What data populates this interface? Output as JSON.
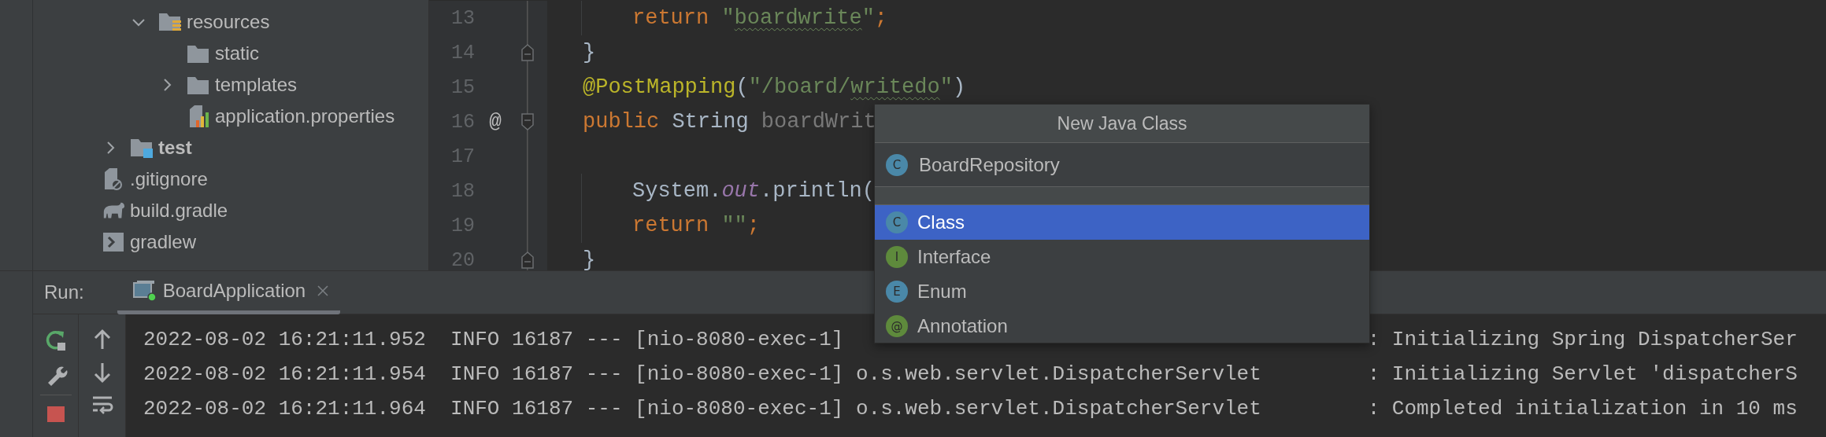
{
  "project_tree": {
    "items": [
      {
        "children": [
          {
            "children": [
              {
                "kind": "resources-folder",
                "label": "resources",
                "expanded": true,
                "children": [
                  {
                    "kind": "folder",
                    "label": "static"
                  },
                  {
                    "kind": "folder",
                    "label": "templates",
                    "expanded": false
                  },
                  {
                    "kind": "properties-file",
                    "label": "application.properties"
                  }
                ]
              }
            ]
          },
          {
            "kind": "test-folder",
            "label": "test",
            "expanded": false
          }
        ]
      },
      {
        "kind": "ignore-file",
        "label": ".gitignore"
      },
      {
        "kind": "gradle-file",
        "label": "build.gradle"
      },
      {
        "kind": "script-file",
        "label": "gradlew"
      }
    ]
  },
  "editor": {
    "lines": [
      {
        "number": "13",
        "indented": true,
        "tokens": [
          {
            "kind": "keyword",
            "text": "return"
          },
          {
            "kind": "string",
            "text": "\"",
            "spaced": true
          },
          {
            "kind": "string",
            "text": "boardwrite",
            "typo": true
          },
          {
            "kind": "string",
            "text": "\""
          },
          {
            "kind": "keyword",
            "text": ";"
          }
        ]
      },
      {
        "number": "14",
        "fold_end": true,
        "indented": false,
        "tokens": [
          {
            "kind": "plain",
            "text": "}"
          }
        ]
      },
      {
        "number": "15",
        "indented": false,
        "tokens": [
          {
            "kind": "annotation",
            "text": "@PostMapping"
          },
          {
            "kind": "plain",
            "text": "("
          },
          {
            "kind": "string",
            "text": "\"/board/"
          },
          {
            "kind": "string",
            "text": "writedo",
            "typo": true
          },
          {
            "kind": "string",
            "text": "\""
          },
          {
            "kind": "plain",
            "text": ")"
          }
        ]
      },
      {
        "number": "16",
        "marker": "@",
        "fold_start": true,
        "indented": false,
        "tokens": [
          {
            "kind": "keyword",
            "text": "public"
          },
          {
            "kind": "plain",
            "text": " String "
          },
          {
            "kind": "unused",
            "text": "boardWrit"
          }
        ]
      },
      {
        "number": "17",
        "indented": false
      },
      {
        "number": "18",
        "indented": true,
        "tokens": [
          {
            "kind": "plain",
            "text": "System."
          },
          {
            "kind": "field",
            "text": "out"
          },
          {
            "kind": "plain",
            "text": ".println("
          }
        ]
      },
      {
        "number": "19",
        "indented": true,
        "tokens": [
          {
            "kind": "keyword",
            "text": "return"
          },
          {
            "kind": "string",
            "text": "\"\"",
            "spaced": true
          },
          {
            "kind": "keyword",
            "text": ";"
          }
        ]
      },
      {
        "number": "20",
        "fold_end": true,
        "indented": false,
        "tokens": [
          {
            "kind": "plain",
            "text": "}"
          }
        ]
      }
    ]
  },
  "popup": {
    "title": "New Java Class",
    "name_field": {
      "badge": "C",
      "value": "BoardRepository"
    },
    "items": [
      {
        "badge": "C",
        "kind": "class",
        "label": "Class",
        "selected": true
      },
      {
        "badge": "I",
        "kind": "interface",
        "label": "Interface",
        "selected": false
      },
      {
        "badge": "E",
        "kind": "enum",
        "label": "Enum",
        "selected": false
      },
      {
        "badge": "@",
        "kind": "annotation",
        "label": "Annotation",
        "selected": false
      }
    ]
  },
  "run_panel": {
    "label": "Run:",
    "tab": {
      "title": "BoardApplication",
      "running": true
    },
    "console": [
      {
        "prefix": "2022-08-02 16:21:11.952  INFO 16187 --- [nio-8080-exec-1]",
        "message": ": Initializing Spring DispatcherSer"
      },
      {
        "prefix": "2022-08-02 16:21:11.954  INFO 16187 --- [nio-8080-exec-1]",
        "logger": "o.s.web.servlet.DispatcherServlet",
        "message": ": Initializing Servlet 'dispatcherS"
      },
      {
        "prefix": "2022-08-02 16:21:11.964  INFO 16187 --- [nio-8080-exec-1]",
        "logger": "o.s.web.servlet.DispatcherServlet",
        "message": ": Completed initialization in 10 ms"
      }
    ]
  }
}
